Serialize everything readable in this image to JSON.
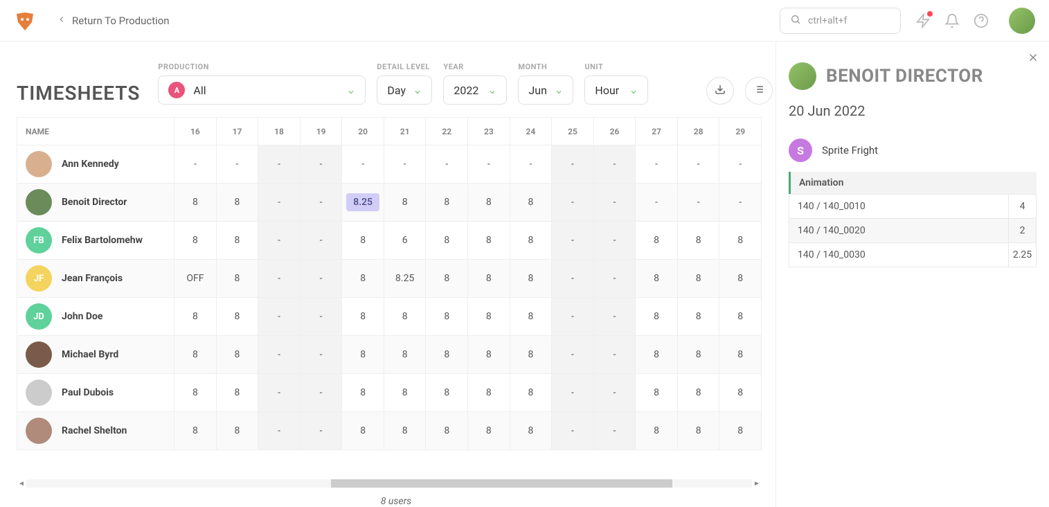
{
  "header": {
    "back_label": "Return To Production",
    "search_placeholder": "ctrl+alt+f"
  },
  "page": {
    "title": "TIMESHEETS",
    "footer": "8 users"
  },
  "filters": {
    "production_label": "PRODUCTION",
    "production_value": "All",
    "production_badge": "A",
    "detail_label": "DETAIL LEVEL",
    "detail_value": "Day",
    "year_label": "YEAR",
    "year_value": "2022",
    "month_label": "MONTH",
    "month_value": "Jun",
    "unit_label": "UNIT",
    "unit_value": "Hour"
  },
  "table": {
    "name_header": "NAME",
    "days": [
      "16",
      "17",
      "18",
      "19",
      "20",
      "21",
      "22",
      "23",
      "24",
      "25",
      "26",
      "27",
      "28",
      "29"
    ],
    "weekend_idx": [
      2,
      3,
      9,
      10
    ],
    "rows": [
      {
        "name": "Ann Kennedy",
        "avatar_type": "photo",
        "avatar_bg": "#d8b090",
        "cells": [
          "-",
          "-",
          "-",
          "-",
          "-",
          "-",
          "-",
          "-",
          "-",
          "-",
          "-",
          "-",
          "-",
          "-"
        ]
      },
      {
        "name": "Benoit Director",
        "avatar_type": "photo",
        "avatar_bg": "#6b8b5a",
        "cells": [
          "8",
          "8",
          "-",
          "-",
          "8.25",
          "8",
          "8",
          "8",
          "8",
          "-",
          "-",
          "-",
          "-",
          "-"
        ],
        "selected_idx": 4
      },
      {
        "name": "Felix Bartolomehw",
        "avatar_type": "initials",
        "initials": "FB",
        "avatar_bg": "#5fd19a",
        "cells": [
          "8",
          "8",
          "-",
          "-",
          "8",
          "6",
          "8",
          "8",
          "8",
          "-",
          "-",
          "8",
          "8",
          "8"
        ]
      },
      {
        "name": "Jean François",
        "avatar_type": "initials",
        "initials": "JF",
        "avatar_bg": "#f4d35e",
        "cells": [
          "OFF",
          "8",
          "-",
          "-",
          "8",
          "8.25",
          "8",
          "8",
          "8",
          "-",
          "-",
          "8",
          "8",
          "8"
        ]
      },
      {
        "name": "John Doe",
        "avatar_type": "initials",
        "initials": "JD",
        "avatar_bg": "#5fd19a",
        "cells": [
          "8",
          "8",
          "-",
          "-",
          "8",
          "8",
          "8",
          "8",
          "8",
          "-",
          "-",
          "8",
          "8",
          "8"
        ]
      },
      {
        "name": "Michael Byrd",
        "avatar_type": "photo",
        "avatar_bg": "#7a5a4a",
        "cells": [
          "8",
          "8",
          "-",
          "-",
          "8",
          "8",
          "8",
          "8",
          "8",
          "-",
          "-",
          "8",
          "8",
          "8"
        ]
      },
      {
        "name": "Paul Dubois",
        "avatar_type": "photo",
        "avatar_bg": "#cccccc",
        "cells": [
          "8",
          "8",
          "-",
          "-",
          "8",
          "8",
          "8",
          "8",
          "8",
          "-",
          "-",
          "8",
          "8",
          "8"
        ]
      },
      {
        "name": "Rachel Shelton",
        "avatar_type": "photo",
        "avatar_bg": "#b08a7a",
        "cells": [
          "8",
          "8",
          "-",
          "-",
          "8",
          "8",
          "8",
          "8",
          "8",
          "-",
          "-",
          "8",
          "8",
          "8"
        ]
      }
    ]
  },
  "side": {
    "person": "BENOIT DIRECTOR",
    "date": "20 Jun 2022",
    "project_badge": "S",
    "project_color": "#c679e0",
    "project_name": "Sprite Fright",
    "section_title": "Animation",
    "tasks": [
      {
        "name": "140 / 140_0010",
        "hours": "4"
      },
      {
        "name": "140 / 140_0020",
        "hours": "2"
      },
      {
        "name": "140 / 140_0030",
        "hours": "2.25"
      }
    ]
  }
}
